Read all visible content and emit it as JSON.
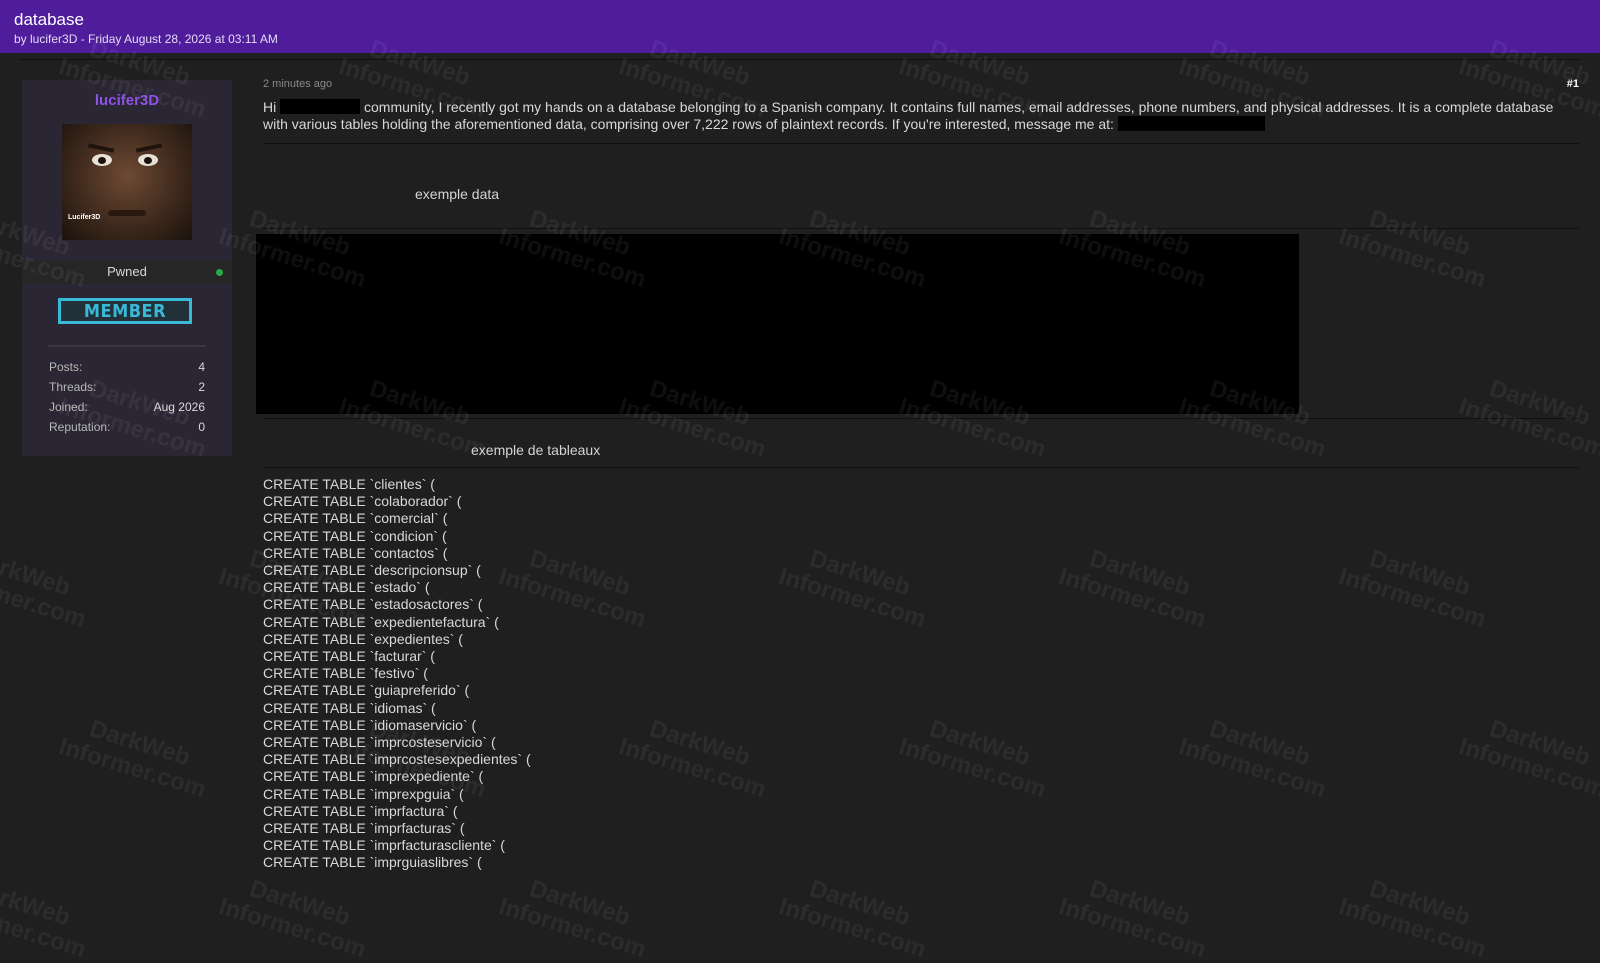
{
  "header": {
    "title": "database",
    "byline": "by lucifer3D - Friday August 28, 2026 at 03:11 AM"
  },
  "user": {
    "name": "lucifer3D",
    "avatar_caption": "Lucifer3D",
    "rank": "Pwned",
    "badge": "MEMBER",
    "stats": [
      {
        "label": "Posts:",
        "value": "4"
      },
      {
        "label": "Threads:",
        "value": "2"
      },
      {
        "label": "Joined:",
        "value": "Aug 2026"
      },
      {
        "label": "Reputation:",
        "value": "0"
      }
    ]
  },
  "post": {
    "time": "2 minutes ago",
    "number": "#1",
    "text_hi": "Hi",
    "text_main": "community, I recently got my hands on a database belonging to a Spanish company. It contains full names, email addresses, phone numbers, and physical addresses. It is a complete database with various tables holding the aforementioned data, comprising over 7,222 rows of plaintext records. If you're interested, message me at:",
    "sample_label": "exemple data",
    "tables_label": "exemple de tableaux",
    "tables": [
      "CREATE TABLE `clientes` (",
      "CREATE TABLE `colaborador` (",
      "CREATE TABLE `comercial` (",
      "CREATE TABLE `condicion` (",
      "CREATE TABLE `contactos` (",
      "CREATE TABLE `descripcionsup` (",
      "CREATE TABLE `estado` (",
      "CREATE TABLE `estadosactores` (",
      "CREATE TABLE `expedientefactura` (",
      "CREATE TABLE `expedientes` (",
      "CREATE TABLE `facturar` (",
      "CREATE TABLE `festivo` (",
      "CREATE TABLE `guiapreferido` (",
      "CREATE TABLE `idiomas` (",
      "CREATE TABLE `idiomaservicio` (",
      "CREATE TABLE `imprcosteservicio` (",
      "CREATE TABLE `imprcostesexpedientes` (",
      "CREATE TABLE `imprexpediente` (",
      "CREATE TABLE `imprexpguia` (",
      "CREATE TABLE `imprfactura` (",
      "CREATE TABLE `imprfacturas` (",
      "CREATE TABLE `imprfacturascliente` (",
      "CREATE TABLE `imprguiaslibres` ("
    ]
  },
  "watermark": {
    "line1": "DarkWeb",
    "line2": "Informer.com"
  },
  "colors": {
    "header": "#4f1c9b",
    "username": "#8f52e8",
    "badge": "#3ab8d8",
    "online": "#2aa84a"
  }
}
